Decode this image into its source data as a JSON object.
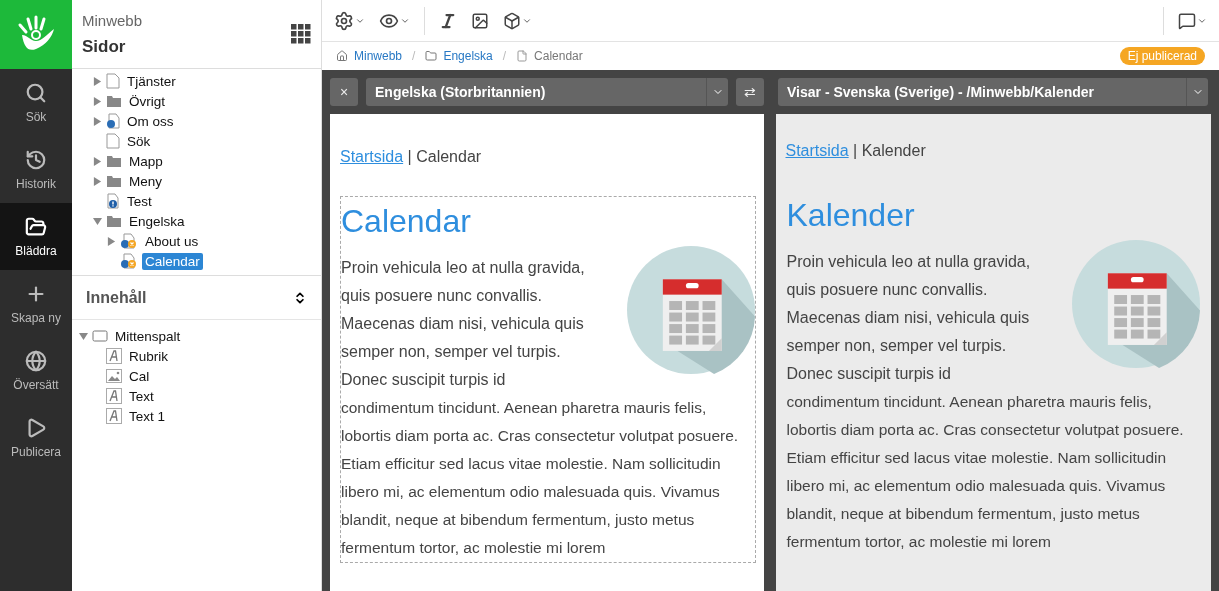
{
  "rail": {
    "items": [
      {
        "label": "Sök",
        "selected": false
      },
      {
        "label": "Historik",
        "selected": false
      },
      {
        "label": "Bläddra",
        "selected": true
      },
      {
        "label": "Skapa ny",
        "selected": false
      },
      {
        "label": "Översätt",
        "selected": false
      },
      {
        "label": "Publicera",
        "selected": false
      }
    ]
  },
  "sidebar": {
    "site": "Minwebb",
    "title": "Sidor",
    "tree": [
      {
        "label": "Tjänster",
        "kind": "blank",
        "expanded": false,
        "selected": false
      },
      {
        "label": "Övrigt",
        "kind": "folder",
        "expanded": false,
        "selected": false
      },
      {
        "label": "Om oss",
        "kind": "globe",
        "expanded": false,
        "selected": false
      },
      {
        "label": "Sök",
        "kind": "page",
        "selected": false
      },
      {
        "label": "Mapp",
        "kind": "folder",
        "expanded": false,
        "selected": false
      },
      {
        "label": "Meny",
        "kind": "folder",
        "expanded": false,
        "selected": false
      },
      {
        "label": "Test",
        "kind": "info",
        "selected": false
      },
      {
        "label": "Engelska",
        "kind": "folder",
        "expanded": true,
        "selected": false,
        "children": [
          {
            "label": "About us",
            "kind": "translation",
            "expanded": false,
            "selected": false
          },
          {
            "label": "Calendar",
            "kind": "translation",
            "selected": true
          }
        ]
      }
    ],
    "content_title": "Innehåll",
    "content_tree": [
      {
        "label": "Mittenspalt",
        "kind": "area",
        "expanded": true,
        "children": [
          {
            "label": "Rubrik",
            "kind": "text"
          },
          {
            "label": "Cal",
            "kind": "image"
          },
          {
            "label": "Text",
            "kind": "text"
          },
          {
            "label": "Text 1",
            "kind": "text"
          }
        ]
      }
    ]
  },
  "breadcrumb": [
    {
      "label": "Minwebb",
      "kind": "home",
      "link": true
    },
    {
      "label": "Engelska",
      "kind": "folder",
      "link": true
    },
    {
      "label": "Calendar",
      "kind": "file",
      "link": false
    }
  ],
  "breadcrumb_separators": [
    "/",
    "/"
  ],
  "status_badge": "Ej publicerad",
  "compare_bar": {
    "close": "×",
    "left_language": "Engelska (Storbritannien)",
    "swap": "⇄",
    "right_view": "Visar - Svenska (Sverige) - /Minwebb/Kalender"
  },
  "panels": [
    {
      "editable": true,
      "crumb_link": "Startsida",
      "crumb_rest": " | Calendar",
      "heading": "Calendar",
      "body_top": "Proin vehicula leo at nulla gravida, quis posuere nunc convallis. Maecenas diam nisi, vehicula quis semper non, semper vel turpis. Donec suscipit turpis id",
      "body_rest": "condimentum tincidunt. Aenean pharetra mauris felis, lobortis diam porta ac. Cras consectetur volutpat posuere. Etiam efficitur sed lacus vitae molestie. Nam sollicitudin libero mi, ac elementum odio malesuada quis. Vivamus blandit, neque at bibendum fermentum, justo metus fermentum tortor, ac molestie mi lorem"
    },
    {
      "editable": false,
      "crumb_link": "Startsida",
      "crumb_rest": " | Kalender",
      "heading": "Kalender",
      "body_top": "Proin vehicula leo at nulla gravida, quis posuere nunc convallis. Maecenas diam nisi, vehicula quis semper non, semper vel turpis. Donec suscipit turpis id",
      "body_rest": "condimentum tincidunt. Aenean pharetra mauris felis, lobortis diam porta ac. Cras consectetur volutpat posuere. Etiam efficitur sed lacus vitae molestie. Nam sollicitudin libero mi, ac elementum odio malesuada quis. Vivamus blandit, neque at bibendum fermentum, justo metus fermentum tortor, ac molestie mi lorem"
    }
  ]
}
